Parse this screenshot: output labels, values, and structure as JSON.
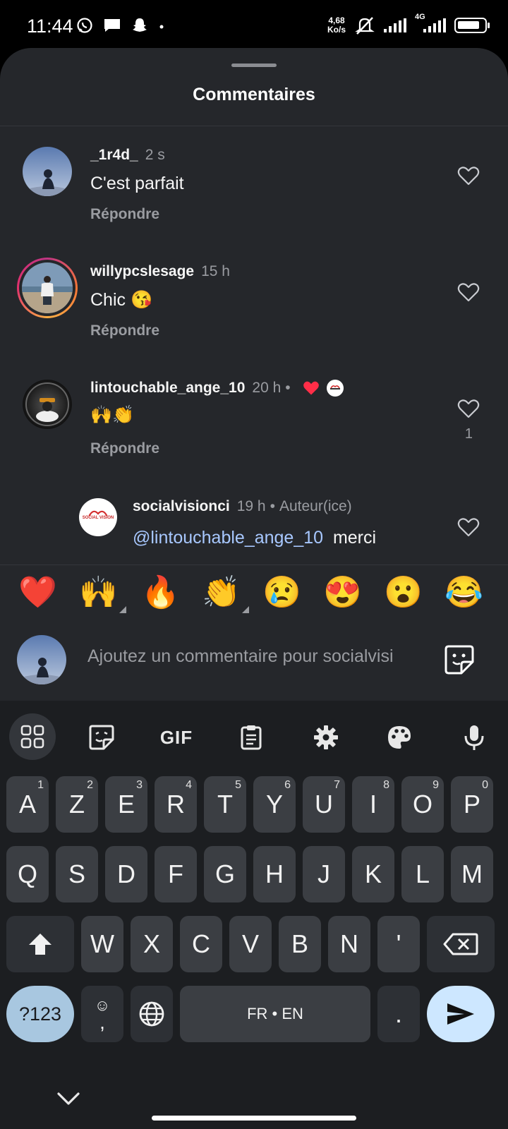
{
  "status_bar": {
    "time": "11:44",
    "speed_value": "4,68",
    "speed_unit": "Ko/s",
    "network": "4G"
  },
  "sheet": {
    "title": "Commentaires"
  },
  "comments": [
    {
      "username": "_1r4d_",
      "time": "2 s",
      "text": "C'est parfait",
      "reply_label": "Répondre"
    },
    {
      "username": "willypcslesage",
      "time": "15 h",
      "text": "Chic 😘",
      "reply_label": "Répondre"
    },
    {
      "username": "lintouchable_ange_10",
      "time": "20 h",
      "meta_sep": "•",
      "text": "🙌👏",
      "reply_label": "Répondre",
      "like_count": "1"
    }
  ],
  "reply": {
    "username": "socialvisionci",
    "time": "19 h",
    "meta_sep": "•",
    "author_badge": "Auteur(ice)",
    "mention": "@lintouchable_ange_10",
    "text": "merci",
    "logo_text": "SOCIAL VISION"
  },
  "emoji_bar": [
    "❤️",
    "🙌",
    "🔥",
    "👏",
    "😢",
    "😍",
    "😮",
    "😂"
  ],
  "comment_input": {
    "placeholder": "Ajoutez un commentaire pour socialvisi"
  },
  "keyboard": {
    "gif_label": "GIF",
    "row1": [
      {
        "k": "A",
        "h": "1"
      },
      {
        "k": "Z",
        "h": "2"
      },
      {
        "k": "E",
        "h": "3"
      },
      {
        "k": "R",
        "h": "4"
      },
      {
        "k": "T",
        "h": "5"
      },
      {
        "k": "Y",
        "h": "6"
      },
      {
        "k": "U",
        "h": "7"
      },
      {
        "k": "I",
        "h": "8"
      },
      {
        "k": "O",
        "h": "9"
      },
      {
        "k": "P",
        "h": "0"
      }
    ],
    "row2": [
      "Q",
      "S",
      "D",
      "F",
      "G",
      "H",
      "J",
      "K",
      "L",
      "M"
    ],
    "row3": [
      "W",
      "X",
      "C",
      "V",
      "B",
      "N",
      "'"
    ],
    "symbols_label": "?123",
    "comma_label": ",",
    "space_label": "FR • EN",
    "period_label": "."
  }
}
